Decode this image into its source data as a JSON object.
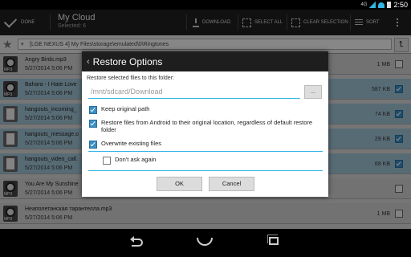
{
  "status": {
    "time": "2:50",
    "network_label": "4G"
  },
  "actionbar": {
    "done_label": "DONE",
    "title": "My Cloud",
    "subtitle": "Selected: 6",
    "download_label": "DOWNLOAD",
    "select_all_label": "SELECT ALL",
    "clear_selection_label": "CLEAR SELECTION",
    "sort_label": "SORT"
  },
  "pathbar": {
    "path": "[LGE NEXUS 4] My Files\\storage\\emulated\\0\\Ringtones"
  },
  "files": [
    {
      "name": "Angry Birds.mp3",
      "date": "5/27/2014 5:06 PM",
      "size": "1 MB",
      "selected": false,
      "icon": "mp3"
    },
    {
      "name": "Bahara - I Hate Love",
      "date": "5/27/2014 5:06 PM",
      "size": "587 KB",
      "selected": true,
      "icon": "mp3"
    },
    {
      "name": "hangouts_incoming_",
      "date": "5/27/2014 5:06 PM",
      "size": "74 KB",
      "selected": true,
      "icon": "doc"
    },
    {
      "name": "hangouts_message.o",
      "date": "5/27/2014 5:06 PM",
      "size": "29 KB",
      "selected": true,
      "icon": "doc"
    },
    {
      "name": "hangouts_video_call.",
      "date": "5/27/2014 5:06 PM",
      "size": "68 KB",
      "selected": true,
      "icon": "doc"
    },
    {
      "name": "You Are My Sunshine",
      "date": "5/27/2014 5:06 PM",
      "size": "",
      "selected": false,
      "icon": "mp3"
    },
    {
      "name": "Неаполетанская тарантелла.mp3",
      "date": "5/27/2014 5:06 PM",
      "size": "1 MB",
      "selected": false,
      "icon": "mp3"
    }
  ],
  "file_icon_label": "MP3",
  "dialog": {
    "title": "Restore Options",
    "folder_label": "Restore selected files to this folder:",
    "folder_placeholder": "/mnt/sdcard/Download",
    "browse_label": "...",
    "options": [
      {
        "label": "Keep original path",
        "checked": true
      },
      {
        "label": "Restore files from Android to their original location, regardless of default restore folder",
        "checked": true
      },
      {
        "label": "Overwrite existing files",
        "checked": true
      }
    ],
    "dont_ask_label": "Don't ask again",
    "dont_ask_checked": false,
    "ok_label": "OK",
    "cancel_label": "Cancel"
  },
  "colors": {
    "accent": "#33b5e5",
    "selected_row": "#9ec4d6",
    "dialog_header": "#1e1e1e"
  }
}
